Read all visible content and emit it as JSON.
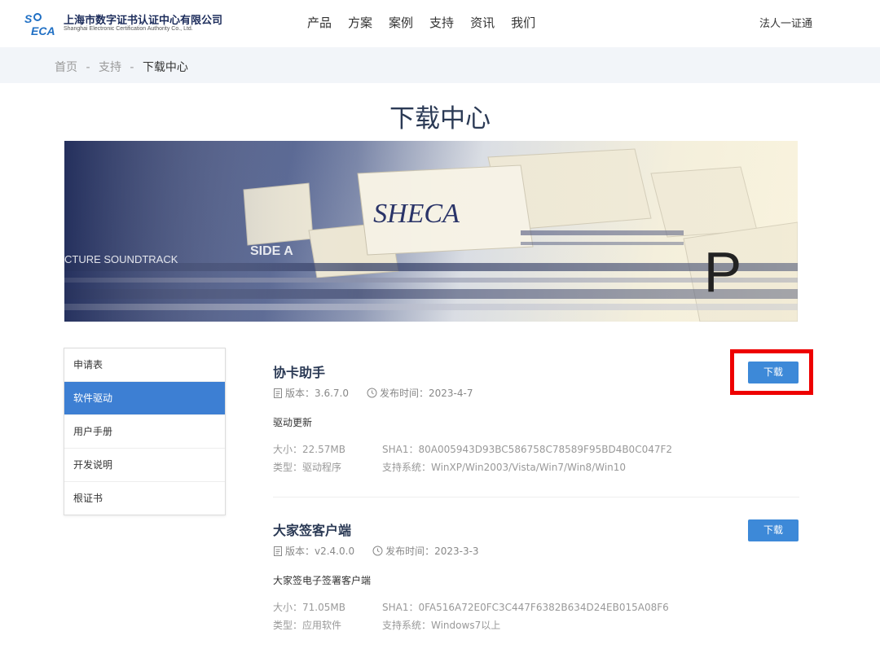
{
  "header": {
    "logo_cn": "上海市数字证书认证中心有限公司",
    "logo_en": "Shanghai Electronic Certification Authority Co., Ltd.",
    "nav": [
      "产品",
      "方案",
      "案例",
      "支持",
      "资讯",
      "我们"
    ],
    "right_link": "法人一证通"
  },
  "breadcrumb": {
    "home": "首页",
    "support": "支持",
    "current": "下载中心",
    "separator": "-"
  },
  "page_title": "下载中心",
  "banner_text": {
    "sheca": "SHECA",
    "letter": "P",
    "side": "SIDE A",
    "soundtrack": "CTURE SOUNDTRACK"
  },
  "sidebar": [
    "申请表",
    "软件驱动",
    "用户手册",
    "开发说明",
    "根证书"
  ],
  "items": [
    {
      "title": "协卡助手",
      "version": "版本：3.6.7.0",
      "date": "发布时间：2023-4-7",
      "desc": "驱动更新",
      "size": "大小：22.57MB",
      "sha1": "SHA1：80A005943D93BC586758C78589F95BD4B0C047F2",
      "type": "类型：驱动程序",
      "systems": "支持系统：WinXP/Win2003/Vista/Win7/Win8/Win10",
      "button": "下载"
    },
    {
      "title": "大家签客户端",
      "version": "版本：v2.4.0.0",
      "date": "发布时间：2023-3-3",
      "desc": "大家签电子签署客户端",
      "size": "大小：71.05MB",
      "sha1": "SHA1：0FA516A72E0FC3C447F6382B634D24EB015A08F6",
      "type": "类型：应用软件",
      "systems": "支持系统：Windows7以上",
      "button": "下载"
    }
  ],
  "colors": {
    "primary": "#3d7fd3",
    "button": "#3d89d8",
    "highlight": "#ee0000",
    "title": "#2b3a55"
  }
}
